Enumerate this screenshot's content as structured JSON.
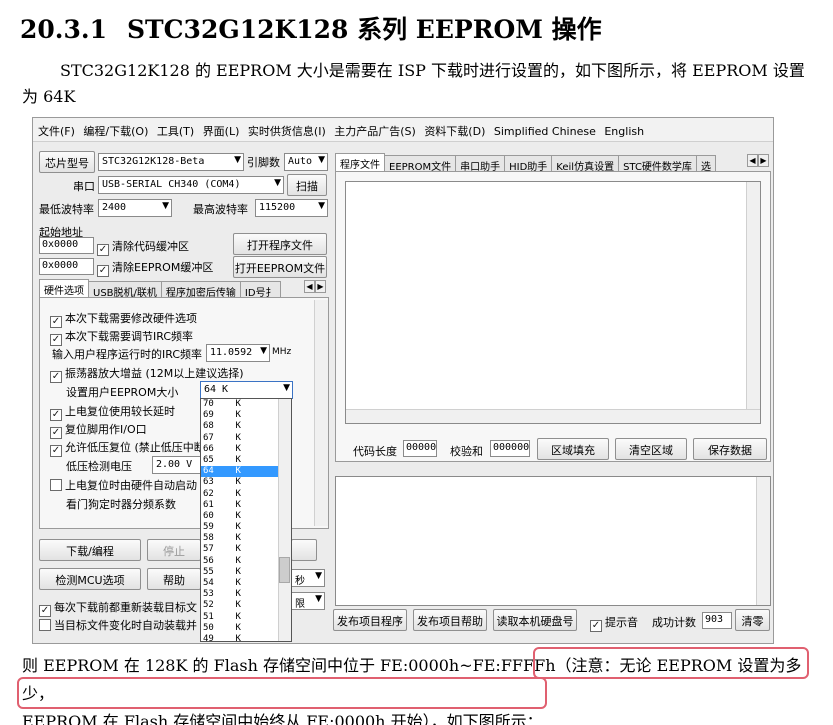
{
  "doc": {
    "section_number": "20.3.1",
    "section_title": "STC32G12K128 系列 EEPROM 操作",
    "para1": "STC32G12K128 的 EEPROM 大小是需要在 ISP 下载时进行设置的，如下图所示，将 EEPROM 设置为 64K",
    "para2_a": "则 EEPROM 在 128K 的 Flash 存储空间中位于 FE:0000h~FE:FFFFh",
    "para2_b": "（注意：无论 EEPROM 设置为多少，",
    "para2_c": "EEPROM 在 Flash 存储空间中始终从 FE:0000h 开始）",
    "para2_d": "，如下图所示："
  },
  "menu": [
    "文件(F)",
    "编程/下载(O)",
    "工具(T)",
    "界面(L)",
    "实时供货信息(I)",
    "主力产品广告(S)",
    "资料下载(D)",
    "Simplified Chinese",
    "English"
  ],
  "left": {
    "chip_model_btn": "芯片型号",
    "chip_model_value": "STC32G12K128-Beta",
    "pin_count_label": "引脚数",
    "pin_count_value": "Auto",
    "port_label": "串口",
    "port_value": "USB-SERIAL CH340 (COM4)",
    "scan_btn": "扫描",
    "min_baud_label": "最低波特率",
    "min_baud_value": "2400",
    "max_baud_label": "最高波特率",
    "max_baud_value": "115200",
    "start_addr_label": "起始地址",
    "addr1": "0x0000",
    "clear_code_buf": "清除代码缓冲区",
    "open_prog_btn": "打开程序文件",
    "addr2": "0x0000",
    "clear_eeprom_buf": "清除EEPROM缓冲区",
    "open_eeprom_btn": "打开EEPROM文件",
    "tabs": [
      "硬件选项",
      "USB脱机/联机",
      "程序加密后传输",
      "ID号扌"
    ],
    "opt1": "本次下载需要修改硬件选项",
    "opt2": "本次下载需要调节IRC频率",
    "irc_label": "输入用户程序运行时的IRC频率",
    "irc_value": "11.0592",
    "irc_unit": "MHz",
    "opt3": "振荡器放大增益 (12M以上建议选择)",
    "eeprom_size_label": "设置用户EEPROM大小",
    "eeprom_size_value": "64    K",
    "opt4": "上电复位使用较长延时",
    "opt5": "复位脚用作I/O口",
    "opt6": "允许低压复位 (禁止低压中断",
    "lvd_label": "低压检测电压",
    "lvd_value": "2.00 V",
    "opt7": "上电复位时由硬件自动启动",
    "wdt_label": "看门狗定时器分频系数",
    "download_btn": "下载/编程",
    "stop_btn": "停止",
    "detect_btn": "检测MCU选项",
    "help_btn": "帮助",
    "sec_value": "秒",
    "limit_value": "限",
    "reload_chk": "每次下载前都重新装载目标文",
    "auto_load_chk": "当目标文件变化时自动装载并"
  },
  "eeprom_options": [
    "70    K",
    "69    K",
    "68    K",
    "67    K",
    "66    K",
    "65    K",
    "64    K",
    "63    K",
    "62    K",
    "61    K",
    "60    K",
    "59    K",
    "58    K",
    "57    K",
    "56    K",
    "55    K",
    "54    K",
    "53    K",
    "52    K",
    "51    K",
    "50    K",
    "49    K"
  ],
  "eeprom_selected": "64    K",
  "right": {
    "tabs": [
      "程序文件",
      "EEPROM文件",
      "串口助手",
      "HID助手",
      "Keil仿真设置",
      "STC硬件数学库",
      "选"
    ],
    "code_len_label": "代码长度",
    "code_len_value": "00000",
    "checksum_label": "校验和",
    "checksum_value": "000000",
    "fill_btn": "区域填充",
    "clear_btn": "清空区域",
    "save_btn": "保存数据",
    "publish_prog_btn": "发布项目程序",
    "publish_help_btn": "发布项目帮助",
    "read_disk_btn": "读取本机硬盘号",
    "sound_chk": "提示音",
    "success_label": "成功计数",
    "success_value": "903",
    "clear_count_btn": "清零"
  }
}
